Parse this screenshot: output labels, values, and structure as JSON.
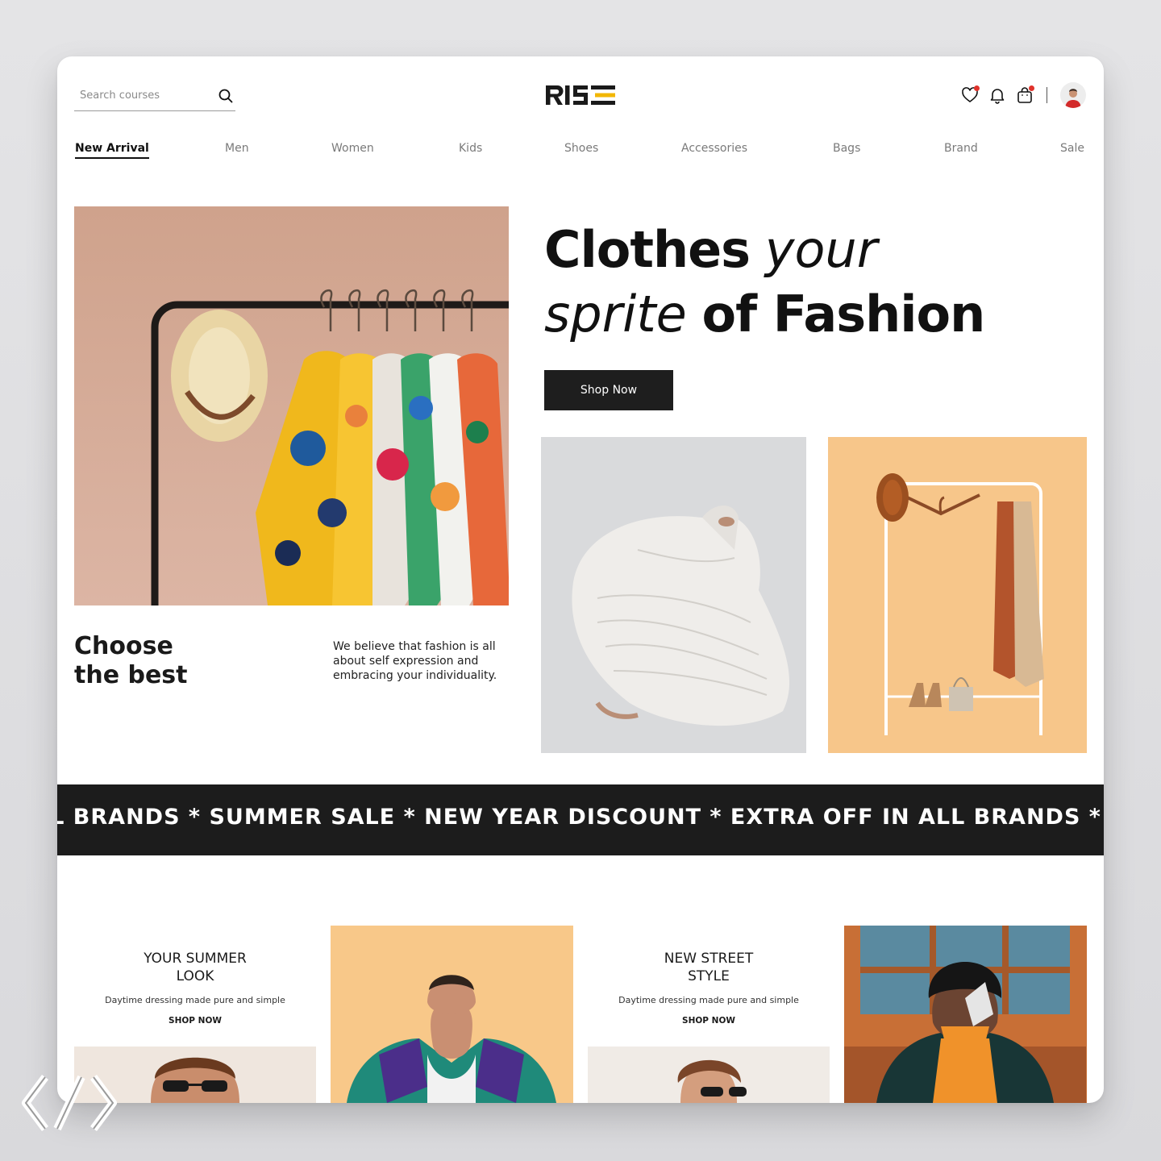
{
  "search": {
    "placeholder": "Search courses"
  },
  "brand": {
    "name": "RISE",
    "accent": "#f2b705"
  },
  "nav": {
    "items": [
      "New Arrival",
      "Men",
      "Women",
      "Kids",
      "Shoes",
      "Accessories",
      "Bags",
      "Brand",
      "Sale"
    ],
    "active": "New Arrival"
  },
  "hero": {
    "line1_bold": "Clothes",
    "line1_light": "your",
    "line2_light": "sprite",
    "line2_bold": "of Fashion",
    "cta": "Shop Now"
  },
  "intro": {
    "heading_line1": "Choose",
    "heading_line2": "the best",
    "body": "We believe that fashion is all about self expression and embracing your individuality."
  },
  "ticker": {
    "text": "LL BRANDS * SUMMER SALE * NEW YEAR DISCOUNT * EXTRA OFF IN ALL BRANDS * SUMMER SALE"
  },
  "promos": [
    {
      "title_line1": "YOUR SUMMER",
      "title_line2": "LOOK",
      "desc": "Daytime dressing made pure and simple",
      "cta": "SHOP NOW"
    },
    {
      "title_line1": "NEW STREET",
      "title_line2": "STYLE",
      "desc": "Daytime dressing made pure and simple",
      "cta": "SHOP NOW"
    }
  ],
  "colors": {
    "dark": "#1c1c1c",
    "notification": "#e0322b",
    "peach": "#f7c68a",
    "hero_bg": "#d8ad98"
  },
  "icons": [
    "search-icon",
    "heart-icon",
    "bell-icon",
    "bag-icon",
    "avatar"
  ]
}
